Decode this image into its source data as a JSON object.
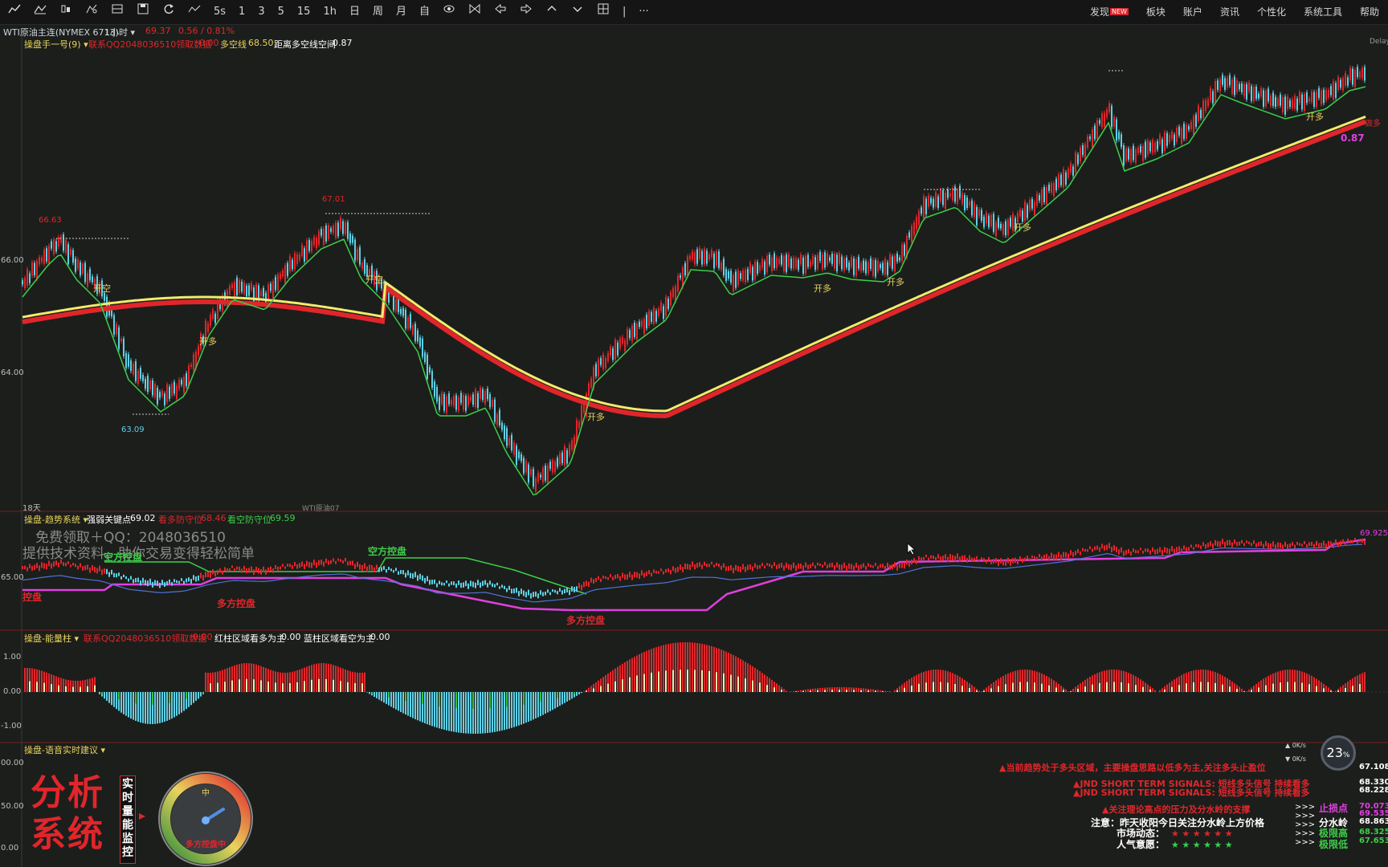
{
  "toolbar": {
    "icons": [
      "line-chart-icon",
      "drawing-icon",
      "candle-icon",
      "indicator-icon",
      "grid-icon",
      "save-icon",
      "refresh-icon",
      "compare-icon",
      "split-icon"
    ],
    "periods": [
      "1",
      "3",
      "5",
      "15",
      "1h",
      "日",
      "周",
      "月",
      "自"
    ],
    "right_items": [
      "发现",
      "板块",
      "账户",
      "资讯",
      "个性化",
      "系统工具",
      "帮助"
    ],
    "new_badge": "NEW"
  },
  "header": {
    "symbol": "WTI原油主连(NYMEX 6713)",
    "timeframe": "1小时",
    "price": "69.37",
    "change": "0.56 / 0.81%"
  },
  "main_chart": {
    "indicator_name": "操盘手一号(9)",
    "contact": "联系QQ2048036510领取数据",
    "contact_value": "0.00",
    "ls_line_label": "多空线",
    "ls_line_value": "68.50",
    "distance_label": "距离多空线空间",
    "distance_value": "0.87",
    "right_tag": "Delay",
    "y_labels": [
      "66.00",
      "64.00"
    ],
    "price_marks": [
      "66.63",
      "67.01",
      "63.09"
    ],
    "signal_label": "开多",
    "signal_label_kong": "开空",
    "right_value": "0.87",
    "right_tag2": "做多",
    "bottom_left": "18天",
    "bottom_mid": "WTI原油07"
  },
  "trend_pane": {
    "title": "操盘-趋势系统",
    "key_point_label": "强弱关键点",
    "key_point_value": "69.02",
    "bull_guard_label": "看多防守位",
    "bull_guard_value": "68.46",
    "bear_guard_label": "看空防守位",
    "bear_guard_value": "69.59",
    "watermark1": "免费领取＋QQ：2048036510",
    "watermark2": "提供技术资料，助你交易变得轻松简单",
    "y_label": "65.00",
    "bear_control": "空方控盘",
    "bull_control": "多方控盘",
    "left_control": "控盘",
    "right_value": "69.925"
  },
  "energy_pane": {
    "title": "操盘-能量柱",
    "contact": "联系QQ2048036510领取数据",
    "contact_value": "0.00",
    "red_label": "红柱区域看多为主",
    "red_value": "0.00",
    "blue_label": "蓝柱区域看空为主",
    "blue_value": "0.00",
    "y_labels": [
      "1.00",
      "0.00",
      "-1.00"
    ]
  },
  "voice_pane": {
    "title": "操盘-语音实时建议",
    "y_labels": [
      "00.00",
      "50.00",
      "0.00"
    ],
    "logo_text": "分析系统",
    "vertical_label": "实时量能监控",
    "gauge_top": "中",
    "gauge_caption": "多方控盘中",
    "line1": "当前趋势处于多头区域，主要操盘思路以低多为主,关注多头止盈位",
    "line2": "JND SHORT TERM SIGNALS: 短线多头信号 持续看多",
    "line3": "JND SHORT TERM SIGNALS: 短线多头信号 持续看多",
    "line4": "关注理论高点的压力及分水岭的支撑",
    "line5": "注意：昨天收阳今日关注分水岭上方价格",
    "line6": "市场动态：",
    "line7": "人气意愿：",
    "arrows": ">>>",
    "r_labels": [
      "止损点",
      "分水岭",
      "极限高",
      "极限低"
    ],
    "r_values": [
      "67.108",
      "68.330",
      "68.228",
      "70.073",
      "69.535",
      "68.863",
      "68.325",
      "67.653"
    ]
  },
  "widget": {
    "percent": "23",
    "unit": "%",
    "up": "0K/s",
    "down": "0K/s"
  },
  "colors": {
    "bull_red": "#e0262b",
    "bear_cyan": "#5fd0e6",
    "yellow_line": "#f2ec6a",
    "magenta": "#e040e0",
    "green": "#3ccf4a",
    "blue_line": "#4e73d6"
  }
}
